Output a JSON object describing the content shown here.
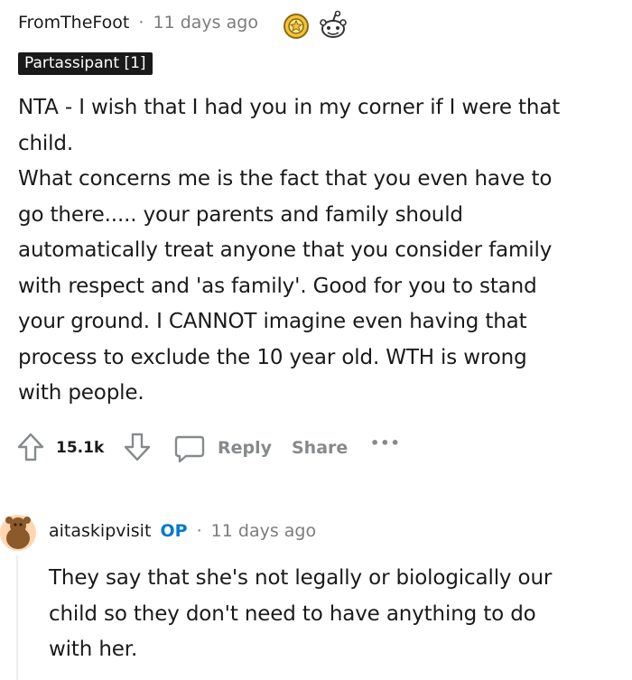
{
  "comment": {
    "username": "FromTheFoot",
    "separator": "·",
    "timestamp": "11 days ago",
    "flair": "Partassipant [1]",
    "body": "NTA - I wish that I had you in my corner if I were that\nchild.\nWhat concerns me is the fact that you even have to\ngo there..... your parents and family should\nautomatically treat anyone that you consider family\nwith respect and 'as family'. Good for you to stand\nyour ground. I CANNOT imagine even having that\nprocess to exclude the 10 year old. WTH is wrong\nwith people.",
    "vote_count": "15.1k",
    "reply_label": "Reply",
    "share_label": "Share",
    "more_label": "•••",
    "award_icons": [
      "award-medal-icon",
      "snoo-award-icon"
    ]
  },
  "reply": {
    "username": "aitaskipvisit",
    "op_badge": "OP",
    "separator": "·",
    "timestamp": "11 days ago",
    "body": "They say that she's not legally or biologically our\nchild so they don't need to have anything to do\nwith her."
  },
  "colors": {
    "text": "#1a1a1b",
    "muted": "#7c7c7c",
    "action": "#878a8c",
    "op_blue": "#0079d3",
    "flair_bg": "#1a1a1b",
    "avatar": "#8b5a2b"
  }
}
